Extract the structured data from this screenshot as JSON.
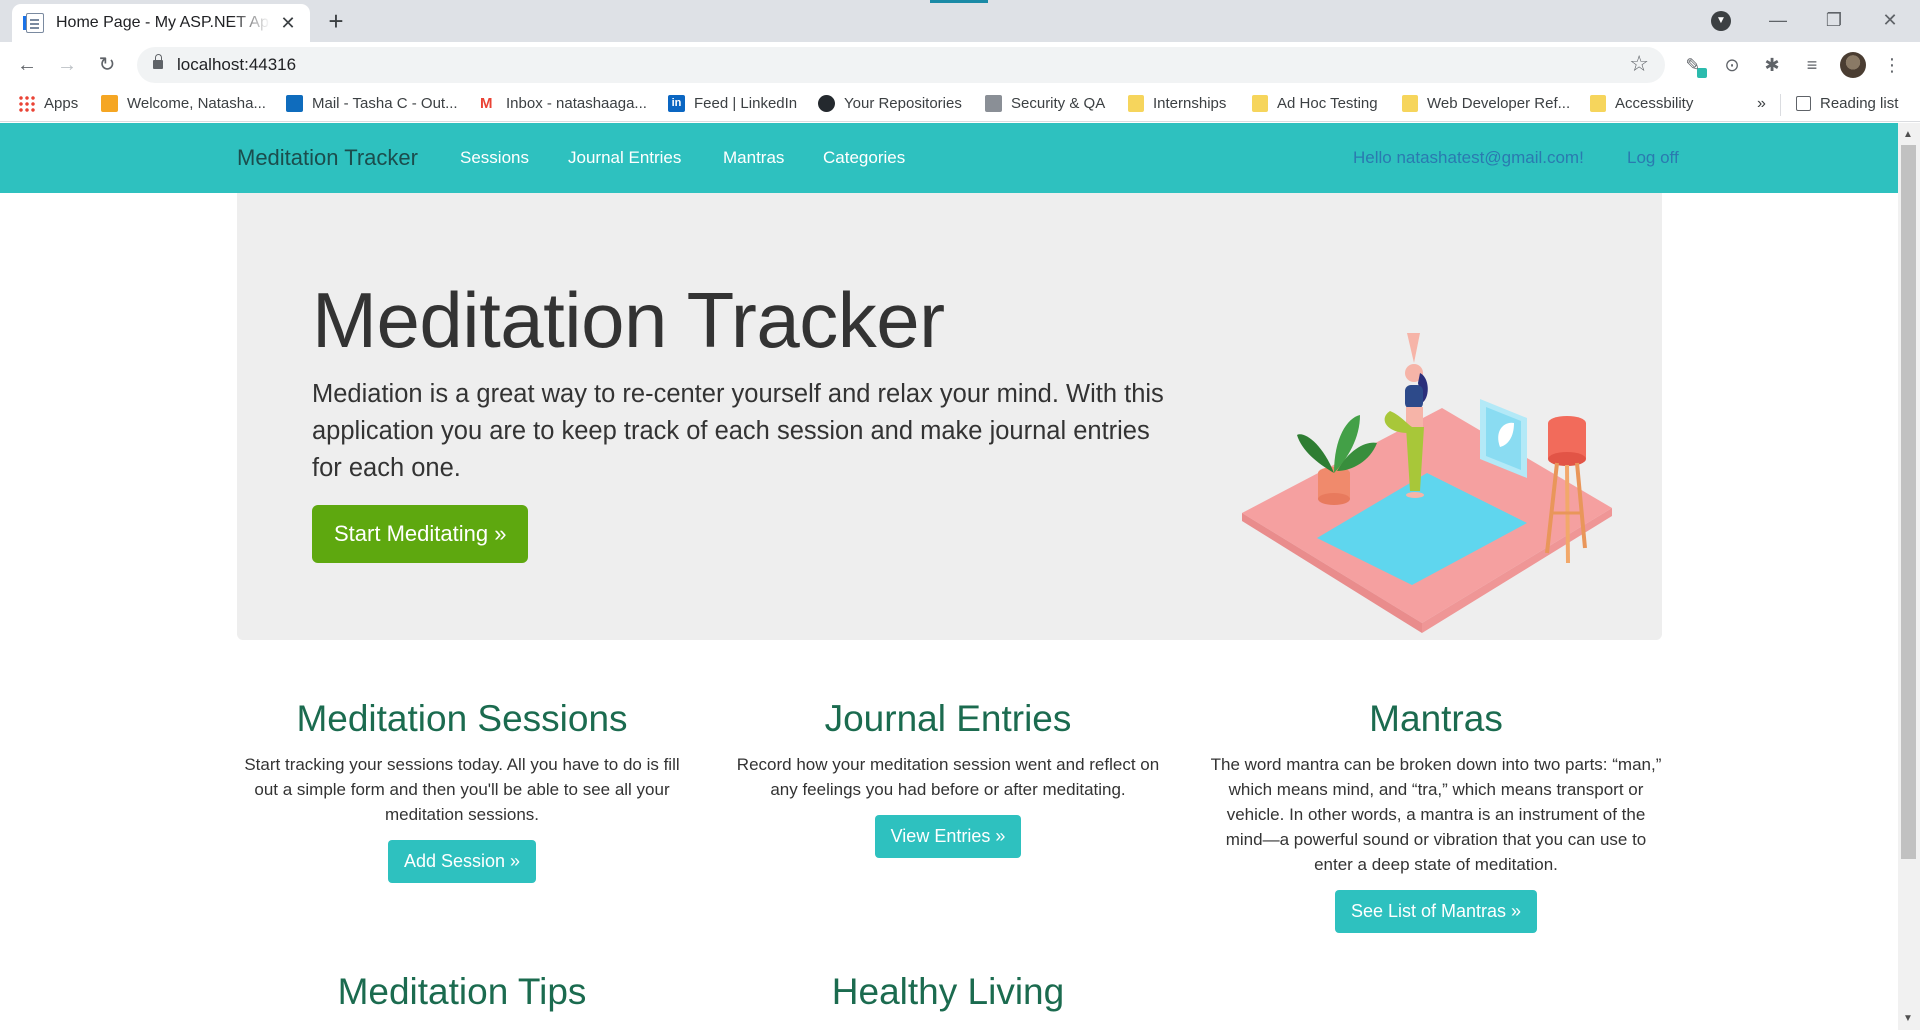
{
  "browser": {
    "tab_title": "Home Page - My ASP.NET Application",
    "tab_close": "✕",
    "new_tab": "+",
    "url": "localhost:44316",
    "reading_list": "Reading list",
    "bookmarks_overflow": "»",
    "bookmarks": [
      {
        "label": "Apps",
        "icon": "apps-grid-icon"
      },
      {
        "label": "Welcome, Natasha...",
        "icon": "app-icon"
      },
      {
        "label": "Mail - Tasha C - Out...",
        "icon": "outlook-icon"
      },
      {
        "label": "Inbox - natashaaga...",
        "icon": "gmail-icon"
      },
      {
        "label": "Feed | LinkedIn",
        "icon": "linkedin-icon"
      },
      {
        "label": "Your Repositories",
        "icon": "github-icon"
      },
      {
        "label": "Security & QA",
        "icon": "site-icon"
      },
      {
        "label": "Internships",
        "icon": "folder-icon"
      },
      {
        "label": "Ad Hoc Testing",
        "icon": "folder-icon"
      },
      {
        "label": "Web Developer Ref...",
        "icon": "folder-icon"
      },
      {
        "label": "Accessbility",
        "icon": "folder-icon"
      }
    ]
  },
  "nav": {
    "brand": "Meditation Tracker",
    "links": [
      "Sessions",
      "Journal Entries",
      "Mantras",
      "Categories"
    ],
    "greeting": "Hello natashatest@gmail.com!",
    "logoff": "Log off"
  },
  "hero": {
    "title": "Meditation Tracker",
    "text": "Mediation is a great way to re-center yourself and relax your mind. With this application you are to keep track of each session and make journal entries for each one.",
    "button": "Start Meditating »"
  },
  "sections": [
    {
      "title": "Meditation Sessions",
      "text": "Start tracking your sessions today. All you have to do is fill out a simple form and then you'll be able to see all your meditation sessions.",
      "button": "Add Session »"
    },
    {
      "title": "Journal Entries",
      "text": "Record how your meditation session went and reflect on any feelings you had before or after meditating.",
      "button": "View Entries »"
    },
    {
      "title": "Mantras",
      "text": "The word mantra can be broken down into two parts: “man,” which means mind, and “tra,” which means transport or vehicle. In other words, a mantra is an instrument of the mind—a powerful sound or vibration that you can use to enter a deep state of meditation.",
      "button": "See List of Mantras »"
    },
    {
      "title": "Meditation Tips"
    },
    {
      "title": "Healthy Living"
    }
  ],
  "colors": {
    "navbar": "#2ec1bf",
    "hero_button": "#5ea80f",
    "heading": "#1b6b4f"
  }
}
